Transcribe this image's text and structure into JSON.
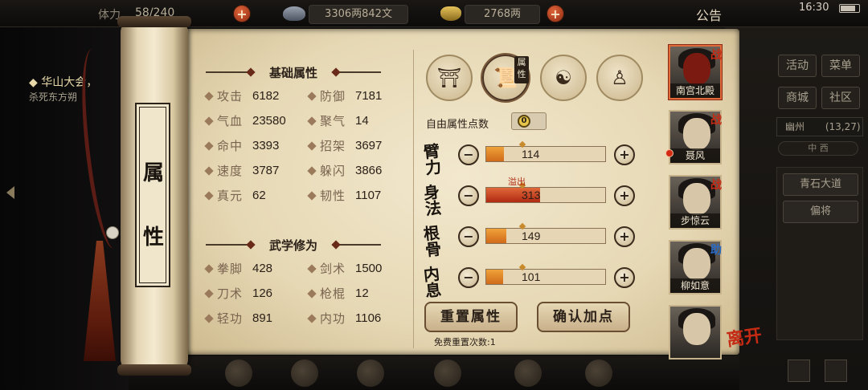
{
  "topbar": {
    "stamina_label": "体力",
    "stamina": "58/240",
    "money": "3306两842文",
    "gold": "2768两",
    "announce": "公告",
    "time": "16:30"
  },
  "quest": {
    "title": "◆ 华山大会，",
    "subtitle": "杀死东方朔"
  },
  "right_menu": {
    "activity": "活动",
    "menu": "菜单",
    "mall": "商城",
    "community": "社区",
    "location": "幽州",
    "coords": "(13,27)",
    "compass": "中 西",
    "place": "青石大道",
    "general": "偏将"
  },
  "scroll": {
    "label": "属性"
  },
  "basic": {
    "title": "基础属性",
    "stats": [
      {
        "label": "攻击",
        "value": "6182"
      },
      {
        "label": "防御",
        "value": "7181"
      },
      {
        "label": "气血",
        "value": "23580"
      },
      {
        "label": "聚气",
        "value": "14"
      },
      {
        "label": "命中",
        "value": "3393"
      },
      {
        "label": "招架",
        "value": "3697"
      },
      {
        "label": "速度",
        "value": "3787"
      },
      {
        "label": "躲闪",
        "value": "3866"
      },
      {
        "label": "真元",
        "value": "62"
      },
      {
        "label": "韧性",
        "value": "1107"
      }
    ]
  },
  "martial": {
    "title": "武学修为",
    "stats": [
      {
        "label": "拳脚",
        "value": "428"
      },
      {
        "label": "剑术",
        "value": "1500"
      },
      {
        "label": "刀术",
        "value": "126"
      },
      {
        "label": "枪棍",
        "value": "12"
      },
      {
        "label": "轻功",
        "value": "891"
      },
      {
        "label": "内功",
        "value": "1106"
      }
    ]
  },
  "tabs": {
    "attr_tag": "属性"
  },
  "points": {
    "label": "自由属性点数",
    "value": "0"
  },
  "attributes": [
    {
      "name": "臂力",
      "value": "114",
      "fill": 0.15
    },
    {
      "name": "身法",
      "value": "313",
      "fill": 0.45
    },
    {
      "name": "根骨",
      "value": "149",
      "fill": 0.17
    },
    {
      "name": "内息",
      "value": "101",
      "fill": 0.14
    }
  ],
  "overflow_label": "溢出",
  "buttons": {
    "reset": "重置属性",
    "confirm": "确认加点",
    "free_reset": "免费重置次数:1"
  },
  "party": [
    {
      "name": "南宫北殿",
      "role": "战"
    },
    {
      "name": "聂风",
      "role": "战"
    },
    {
      "name": "步惊云",
      "role": "战"
    },
    {
      "name": "柳如意",
      "role": "助"
    },
    {
      "name": "",
      "role": ""
    }
  ],
  "leave": "离开",
  "colors": {
    "accent": "#c42a14",
    "bar": "#d06a1a",
    "parchment": "#efe6cc"
  }
}
